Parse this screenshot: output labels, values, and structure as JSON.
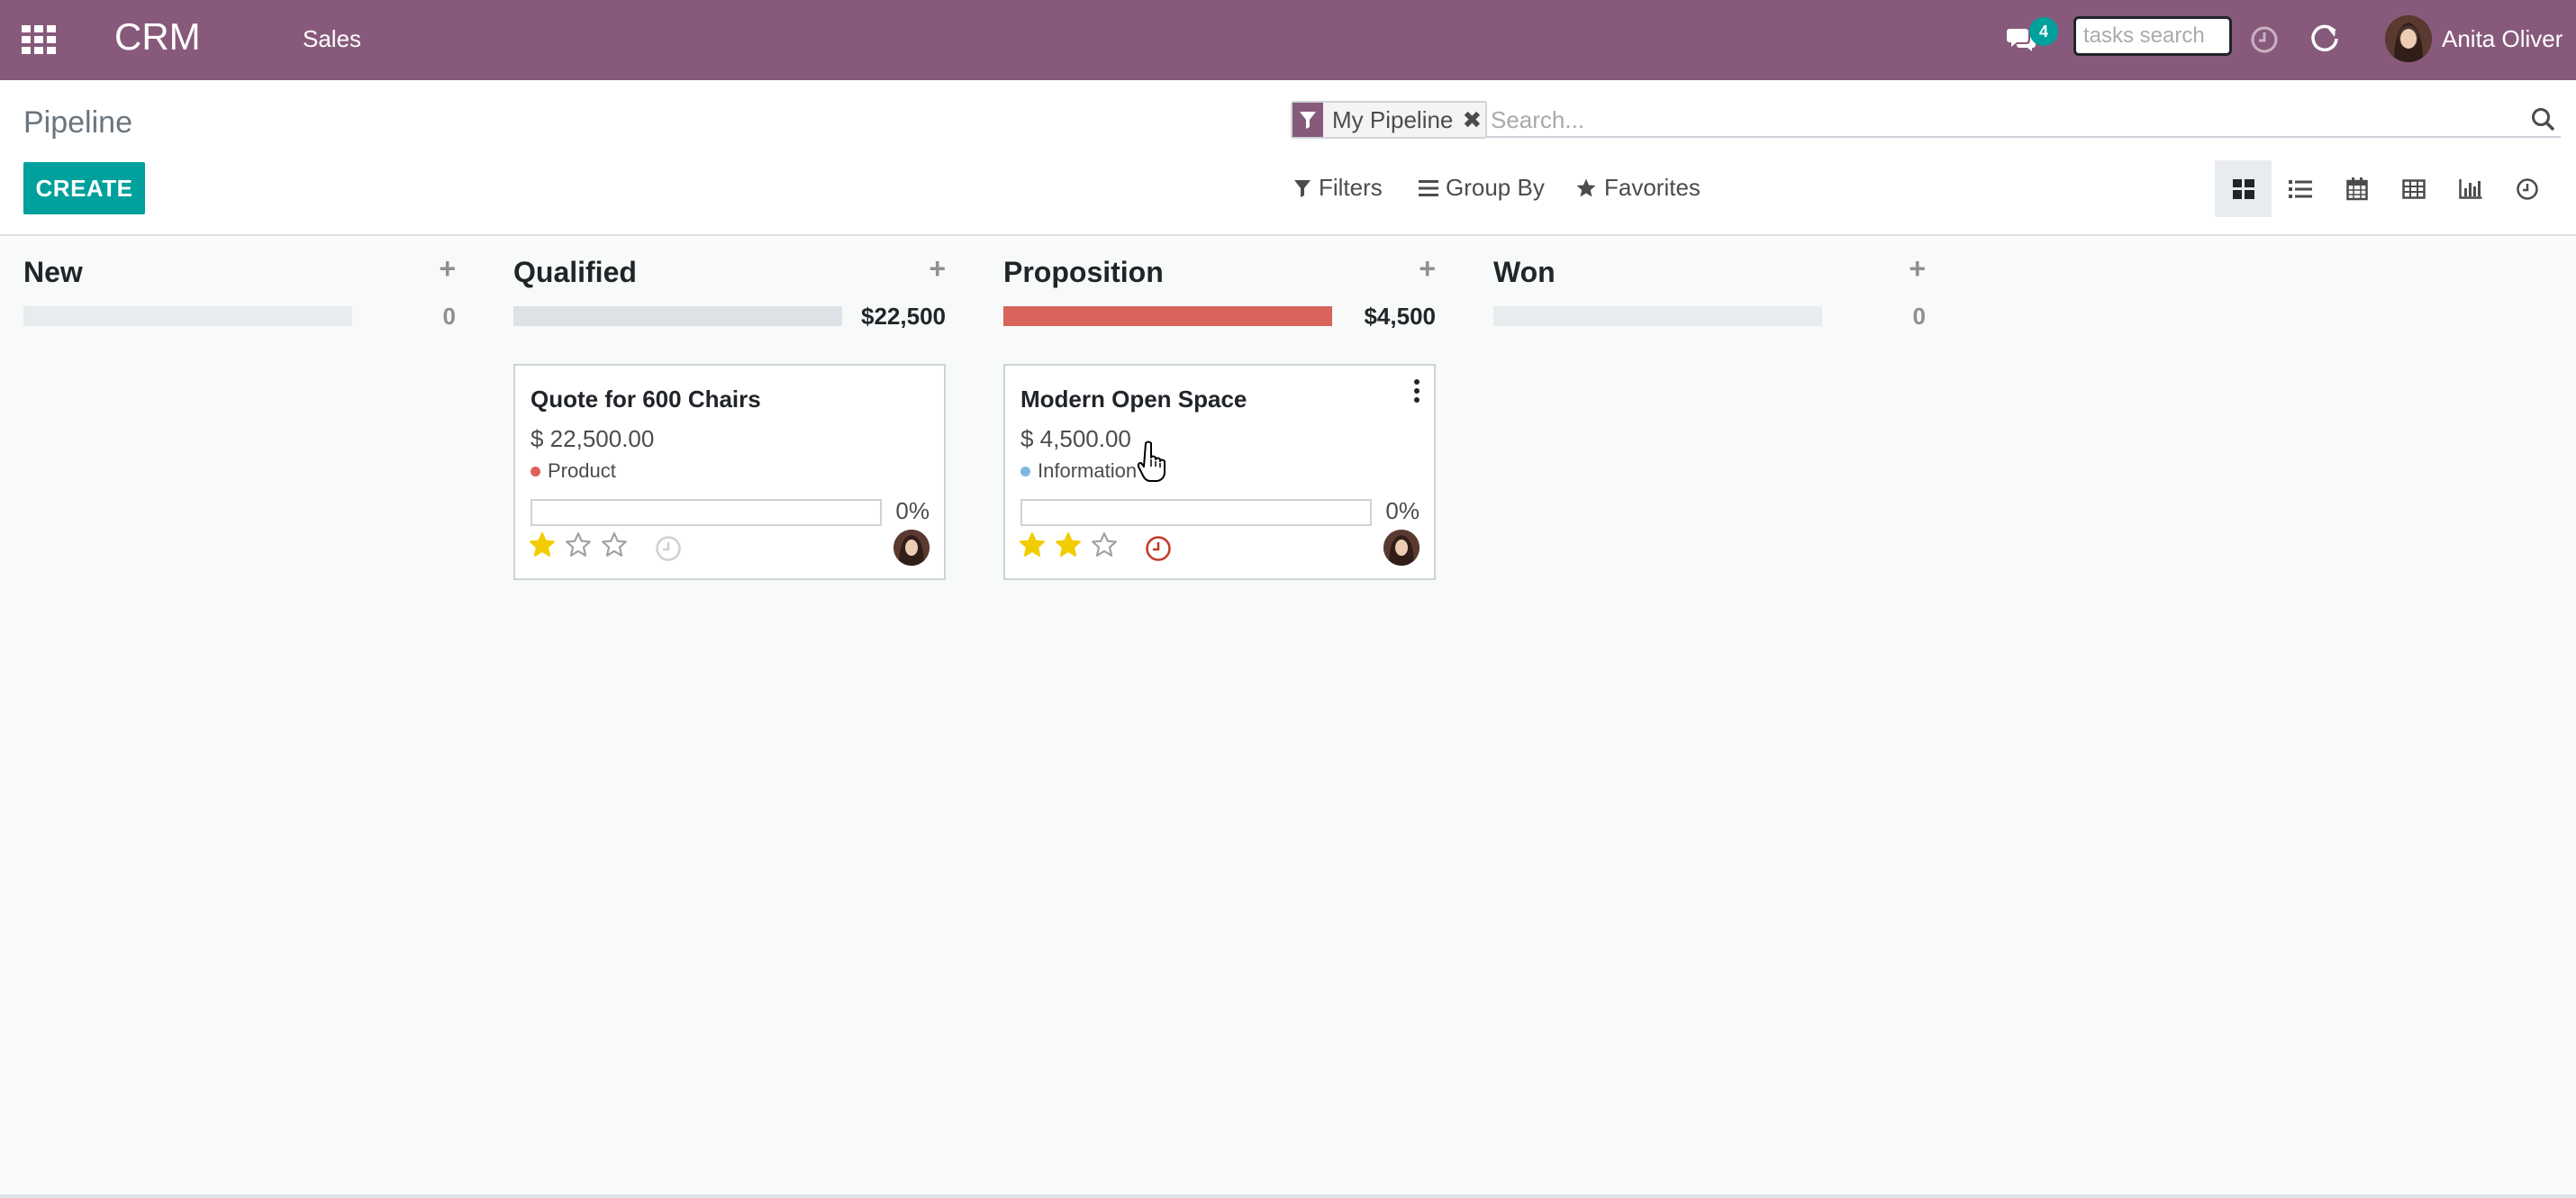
{
  "navbar": {
    "apps_icon": "apps-grid-icon",
    "brand": "CRM",
    "menu": [
      "Sales"
    ],
    "chat_icon": "chat-bubbles-icon",
    "chat_badge": "4",
    "tasks_search_placeholder": "tasks search",
    "activity_icon": "clock-icon",
    "refresh_icon": "refresh-icon",
    "user_name": "Anita Oliver"
  },
  "control_panel": {
    "breadcrumb": "Pipeline",
    "create_label": "CREATE",
    "search": {
      "facet_icon": "filter-icon",
      "facet_label": "My Pipeline",
      "facet_remove_glyph": "✖",
      "placeholder": "Search...",
      "search_icon": "search-icon"
    },
    "filters_label": "Filters",
    "group_by_label": "Group By",
    "favorites_label": "Favorites",
    "views": [
      "kanban",
      "list",
      "calendar",
      "pivot",
      "graph",
      "activity"
    ],
    "active_view": "kanban"
  },
  "columns": [
    {
      "title": "New",
      "add_glyph": "+",
      "total": "0",
      "progress_fraction": 0,
      "progress_color": "#e9ecef"
    },
    {
      "title": "Qualified",
      "add_glyph": "+",
      "total": "$22,500",
      "progress_fraction": 1,
      "progress_color": "#dee2e6"
    },
    {
      "title": "Proposition",
      "add_glyph": "+",
      "total": "$4,500",
      "progress_fraction": 1,
      "progress_color": "#d9645c"
    },
    {
      "title": "Won",
      "add_glyph": "+",
      "total": "0",
      "progress_fraction": 0,
      "progress_color": "#e9ecef"
    }
  ],
  "cards": [
    {
      "column": "Qualified",
      "title": "Quote for 600 Chairs",
      "amount": "$ 22,500.00",
      "tag": "Product",
      "tag_color": "#e0605a",
      "probability": "0%",
      "progress_fraction": 0,
      "stars": 1,
      "max_stars": 3,
      "activity_state": "none",
      "activity_color": "#d0d0d0"
    },
    {
      "column": "Proposition",
      "title": "Modern Open Space",
      "amount": "$ 4,500.00",
      "tag": "Information",
      "tag_color": "#7ab8e0",
      "probability": "0%",
      "progress_fraction": 0,
      "stars": 2,
      "max_stars": 3,
      "activity_state": "overdue",
      "activity_color": "#c0392b"
    }
  ],
  "colors": {
    "navbar": "#875a7b",
    "primary": "#00a09d",
    "star_filled": "#f3cc00",
    "star_empty": "#a0a0a0"
  }
}
